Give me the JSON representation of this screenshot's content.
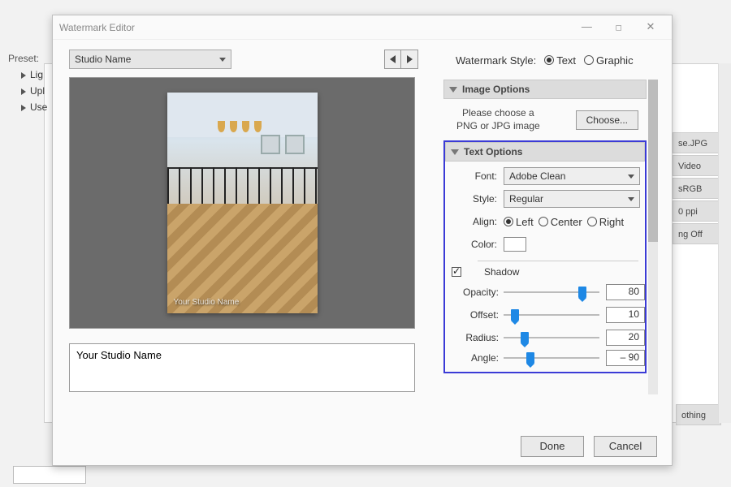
{
  "bg": {
    "preset_label": "Preset:",
    "left_items": [
      "Lig",
      "Upl",
      "Use"
    ],
    "right_items": [
      "se.JPG",
      "Video",
      "sRGB",
      "0 ppi",
      "ng Off"
    ],
    "right_bottom": "othing"
  },
  "dialog": {
    "title": "Watermark Editor",
    "preset_selected": "Studio Name",
    "preview_watermark": "Your Studio Name",
    "text_value": "Your Studio Name",
    "style_label": "Watermark Style:",
    "style_text": "Text",
    "style_graphic": "Graphic",
    "image_options": {
      "header": "Image Options",
      "hint_l1": "Please choose a",
      "hint_l2": "PNG or JPG image",
      "choose": "Choose..."
    },
    "text_options": {
      "header": "Text Options",
      "font_label": "Font:",
      "font_value": "Adobe Clean",
      "style_label": "Style:",
      "style_value": "Regular",
      "align_label": "Align:",
      "align_left": "Left",
      "align_center": "Center",
      "align_right": "Right",
      "color_label": "Color:"
    },
    "shadow": {
      "label": "Shadow",
      "opacity_label": "Opacity:",
      "opacity": "80",
      "offset_label": "Offset:",
      "offset": "10",
      "radius_label": "Radius:",
      "radius": "20",
      "angle_label": "Angle:",
      "angle": "– 90"
    },
    "done": "Done",
    "cancel": "Cancel"
  }
}
